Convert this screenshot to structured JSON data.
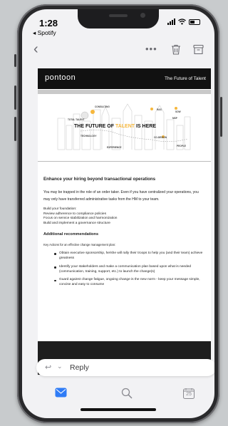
{
  "status_bar": {
    "time": "1:28",
    "back_app": "◂ Spotify"
  },
  "toolbar": {
    "back_icon": "chevron-left-icon",
    "more_icon": "more-icon",
    "trash_icon": "trash-icon",
    "archive_icon": "archive-icon"
  },
  "email": {
    "logo": "pontoon",
    "tagline": "The Future of Talent",
    "hero": {
      "title_prefix": "THE FUTURE OF ",
      "title_accent": "TALENT",
      "title_suffix": " IS HERE",
      "labels": [
        "CONSULTING",
        "TOTAL TALENT",
        "RAS",
        "SOW",
        "MSP",
        "TECHNOLOGY",
        "CO-DESIGN",
        "EXPERIENCE",
        "PEOPLE"
      ]
    },
    "heading": "Enhance your hiring beyond transactional operations",
    "paragraph": "You may be trapped in the role of an order taker.  Even if you have centralized your operations, you may only have transferred administrative tasks from the HM to your team.",
    "foundation": {
      "title": "Build your foundation:",
      "items": [
        "Review adherence to compliance policies",
        "Focus on service stabilization and harmonization",
        "Build and implement a governance structure"
      ]
    },
    "recommendations_heading": "Additional recommendations",
    "key_actions": "Key Actions for an effective change management plan:",
    "bullets": [
      "Obtain executive sponsorship, he/she will rally their troops to help you (and their team) achieve greatness",
      "Identify your stakeholders and make a communication plan based upon what is needed (communication, training, support, etc.) to launch the change(s)",
      " Guard against change fatigue, ongoing change is the new norm - keep your message simple, concise and easy to consume"
    ]
  },
  "reply": {
    "label": "Reply"
  },
  "tabbar": {
    "calendar_day": "25"
  },
  "colors": {
    "accent": "#f6b73c",
    "ios_blue": "#2f7cf6",
    "banner": "#111111"
  }
}
